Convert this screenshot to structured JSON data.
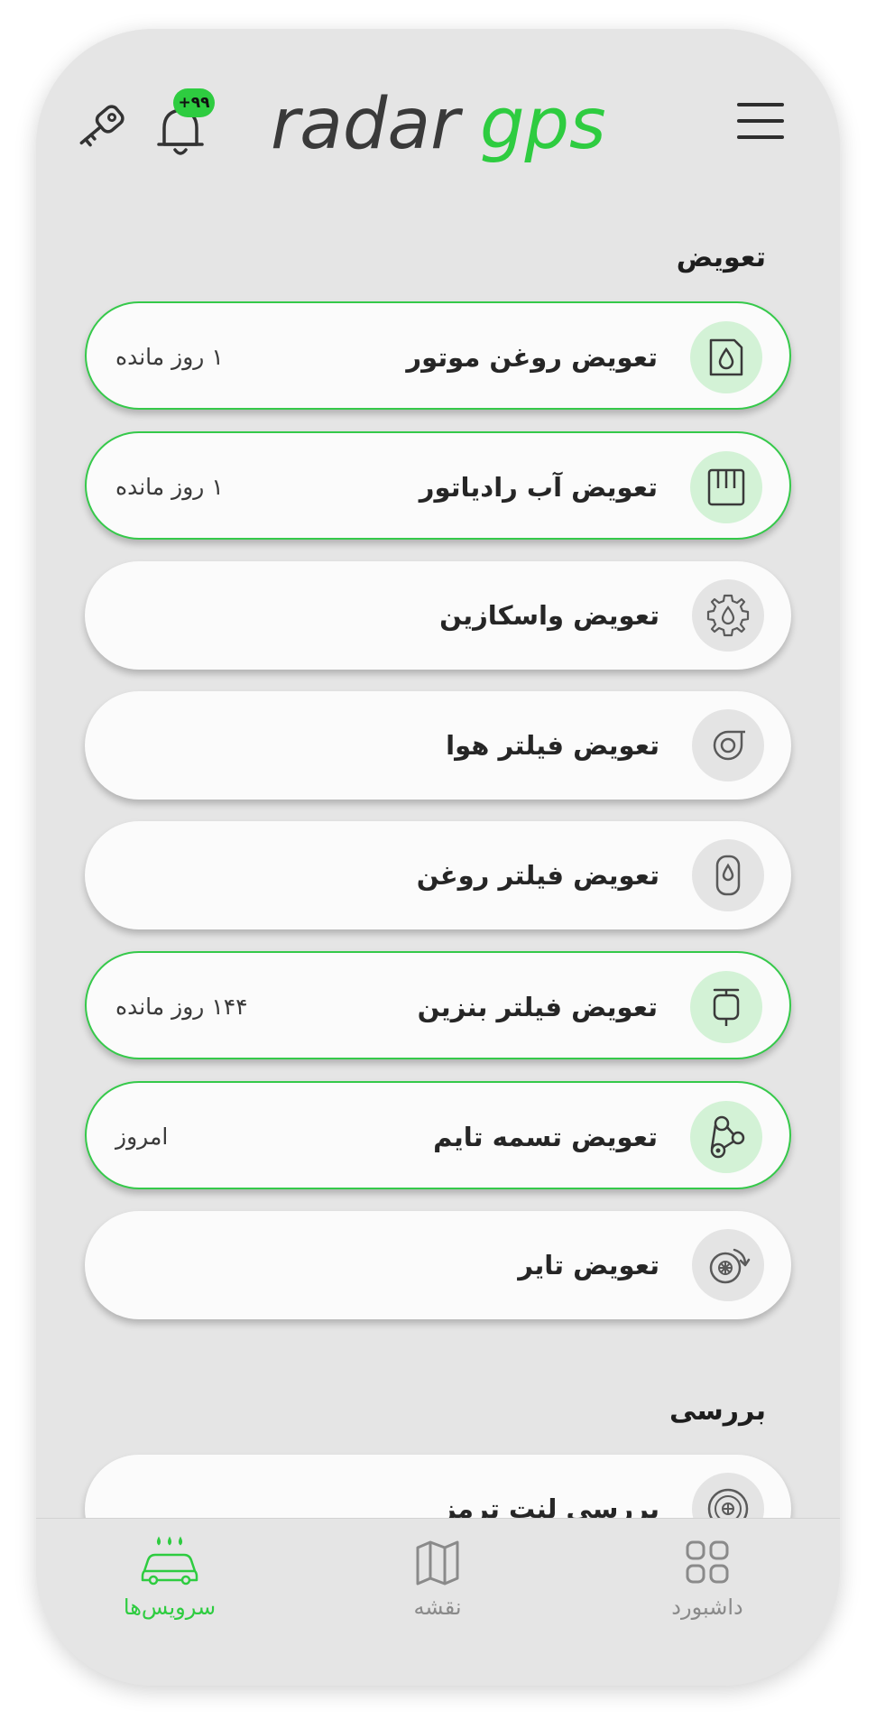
{
  "header": {
    "logo_part1": "radar",
    "logo_part2": "gps",
    "notification_count": "+۹۹"
  },
  "colors": {
    "accent": "#2ecc40",
    "active_icon_bg": "#d3f2d6",
    "inactive_icon_bg": "#e4e4e4"
  },
  "sections": {
    "replace_title": "تعویض",
    "inspect_title": "بررسی"
  },
  "replace_items": [
    {
      "label": "تعویض روغن موتور",
      "remaining": "۱ روز مانده",
      "icon": "oil-can-icon"
    },
    {
      "label": "تعویض آب رادیاتور",
      "remaining": "۱ روز مانده",
      "icon": "radiator-icon"
    },
    {
      "label": "تعویض واسکازین",
      "remaining": "",
      "icon": "gear-oil-icon"
    },
    {
      "label": "تعویض فیلتر هوا",
      "remaining": "",
      "icon": "air-filter-icon"
    },
    {
      "label": "تعویض فیلتر روغن",
      "remaining": "",
      "icon": "oil-filter-icon"
    },
    {
      "label": "تعویض فیلتر بنزین",
      "remaining": "۱۴۴ روز مانده",
      "icon": "fuel-filter-icon"
    },
    {
      "label": "تعویض تسمه تایم",
      "remaining": "امروز",
      "icon": "timing-belt-icon"
    },
    {
      "label": "تعویض تایر",
      "remaining": "",
      "icon": "tire-icon"
    }
  ],
  "inspect_items": [
    {
      "label": "بررسی لنت ترمز",
      "icon": "brake-disc-icon"
    }
  ],
  "nav": {
    "services": "سرویس‌ها",
    "map": "نقشه",
    "dashboard": "داشبورد"
  }
}
